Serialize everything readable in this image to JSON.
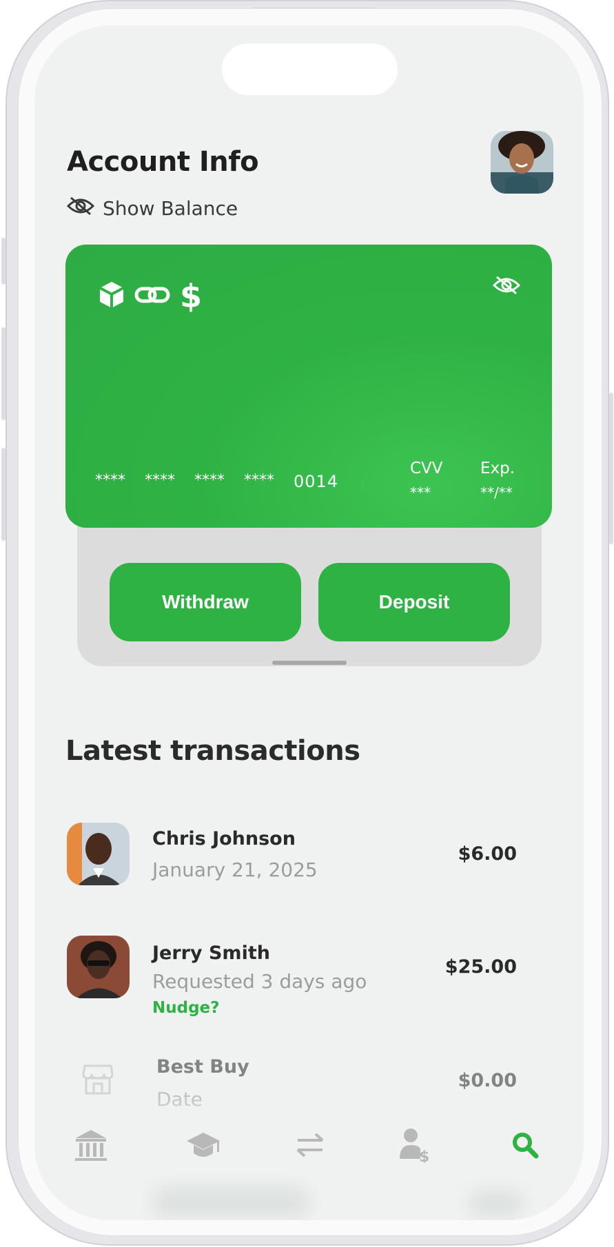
{
  "header": {
    "title": "Account Info",
    "show_balance_label": "Show Balance"
  },
  "card": {
    "number_groups": [
      "****",
      "****",
      "****",
      "****"
    ],
    "last_four": "0014",
    "cvv_label": "CVV",
    "cvv_value": "***",
    "exp_label": "Exp.",
    "exp_value": "**/**",
    "icons": [
      "box-icon",
      "link-icon",
      "dollar-icon"
    ],
    "color": "#2fb244"
  },
  "actions": {
    "withdraw_label": "Withdraw",
    "deposit_label": "Deposit"
  },
  "transactions": {
    "title": "Latest transactions",
    "items": [
      {
        "name": "Chris Johnson",
        "subtitle": "January 21, 2025",
        "amount": "$6.00"
      },
      {
        "name": "Jerry Smith",
        "subtitle": "Requested 3 days ago",
        "action": "Nudge?",
        "amount": "$25.00"
      },
      {
        "name": "Best Buy",
        "subtitle": "Date",
        "amount": "$0.00"
      }
    ]
  },
  "nav": {
    "items": [
      "bank-icon",
      "graduation-cap-icon",
      "transfer-icon",
      "user-dollar-icon",
      "search-icon"
    ],
    "active": "search-icon",
    "accent": "#2fb244"
  }
}
